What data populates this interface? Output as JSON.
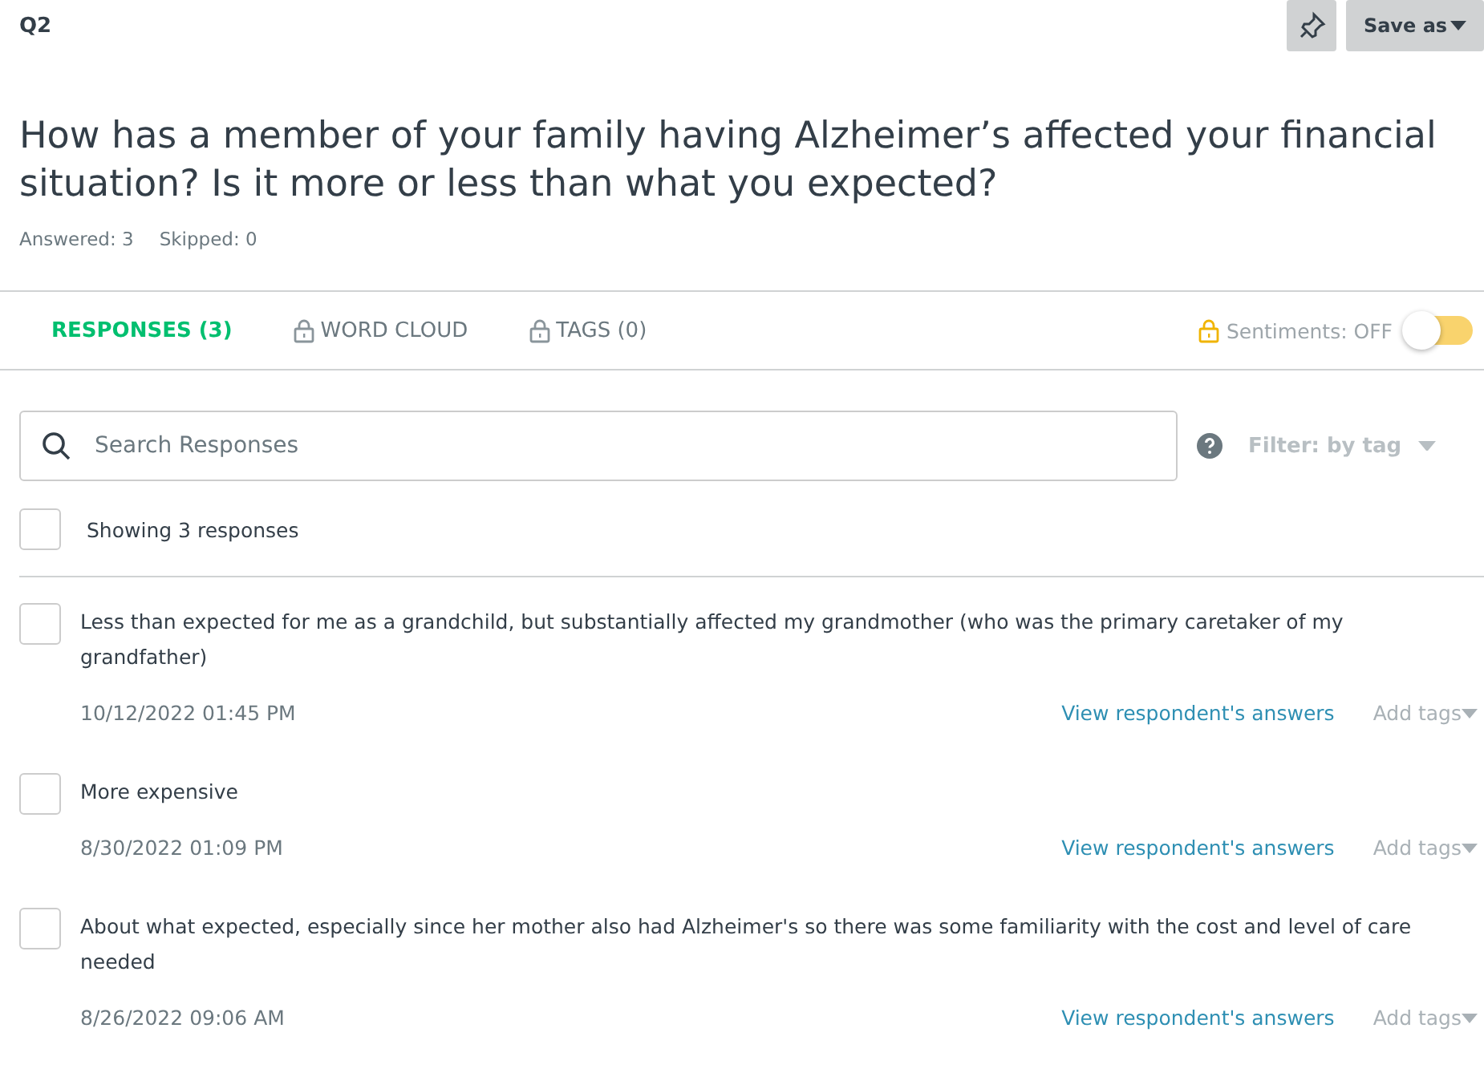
{
  "header": {
    "question_number": "Q2",
    "save_label": "Save as"
  },
  "question": "How has a member of your family having Alzheimer’s affected your financial situation? Is it more or less than what you expected?",
  "stats": [
    "Answered: 3",
    "Skipped: 0"
  ],
  "tabs": [
    {
      "label": "RESPONSES (3)",
      "selected": true,
      "locked": false
    },
    {
      "label": "WORD CLOUD",
      "selected": false,
      "locked": true
    },
    {
      "label": "TAGS (0)",
      "selected": false,
      "locked": true
    }
  ],
  "sentiments": {
    "label": "Sentiments: OFF",
    "on": false
  },
  "search": {
    "placeholder": "Search Responses"
  },
  "filter": {
    "label": "Filter: by tag"
  },
  "select_all": {
    "label": "Showing 3 responses",
    "checked": false
  },
  "responses": [
    {
      "text": "Less than expected for me as a grandchild, but substantially affected my grandmother (who was the primary caretaker of my grandfather)",
      "date": "10/12/2022 01:45 PM",
      "link": "View respondent's answers",
      "tags": "Add tags",
      "checked": false
    },
    {
      "text": "More expensive",
      "date": "8/30/2022 01:09 PM",
      "link": "View respondent's answers",
      "tags": "Add tags",
      "checked": false
    },
    {
      "text": "About what expected, especially since her mother also had Alzheimer's so there was some familiarity with the cost and level of care needed",
      "date": "8/26/2022 09:06 AM",
      "link": "View respondent's answers",
      "tags": "Add tags",
      "checked": false
    }
  ]
}
